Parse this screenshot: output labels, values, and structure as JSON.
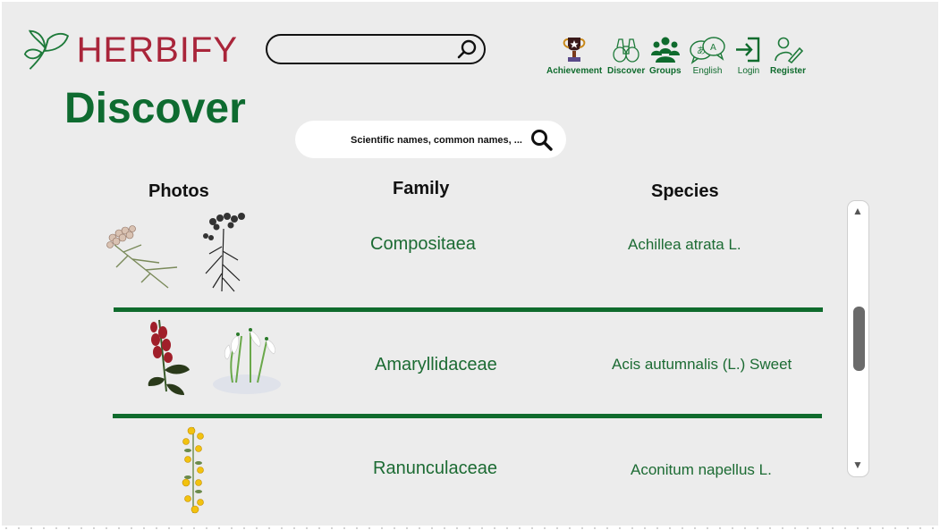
{
  "app": {
    "brand": "HERBIFY"
  },
  "header": {
    "search_placeholder": "",
    "nav": [
      {
        "label": "Achievement",
        "icon": "trophy-icon"
      },
      {
        "label": "Discover",
        "icon": "binoculars-icon"
      },
      {
        "label": "Groups",
        "icon": "groups-icon"
      },
      {
        "label": "English",
        "icon": "language-icon"
      },
      {
        "label": "Login",
        "icon": "login-icon"
      },
      {
        "label": "Register",
        "icon": "register-icon"
      }
    ]
  },
  "page": {
    "title": "Discover",
    "search_placeholder": "Scientific names, common names, ..."
  },
  "table": {
    "headers": {
      "photos": "Photos",
      "family": "Family",
      "species": "Species"
    },
    "rows": [
      {
        "family": "Compositaea",
        "species": "Achillea atrata L."
      },
      {
        "family": "Amaryllidaceae",
        "species": "Acis autumnalis (L.) Sweet"
      },
      {
        "family": "Ranunculaceae",
        "species": "Aconitum napellus L."
      }
    ]
  },
  "scrollbar": {
    "up_arrow": "▲",
    "down_arrow": "▼"
  },
  "colors": {
    "brand_red": "#a9253a",
    "brand_green": "#0e6b30",
    "background": "#ececec"
  }
}
